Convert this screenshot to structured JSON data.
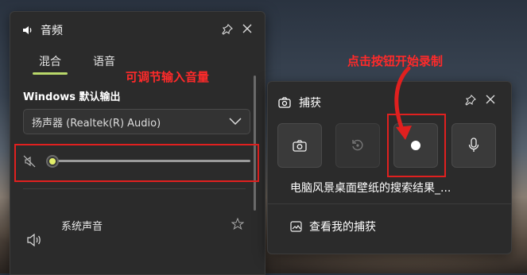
{
  "audio": {
    "title": "音频",
    "tabs": [
      {
        "label": "混合",
        "selected": true
      },
      {
        "label": "语音",
        "selected": false
      }
    ],
    "section_label": "Windows 默认输出",
    "device": "扬声器 (Realtek(R) Audio)",
    "volume": 0,
    "muted": true,
    "app_row_label": "系统声音",
    "accent_color": "#b9d86a"
  },
  "annotations": {
    "volume_hint": "可调节输入音量",
    "record_hint": "点击按钮开始录制",
    "color": "#e0201f"
  },
  "capture": {
    "title": "捕获",
    "filename": "电脑风景桌面壁纸的搜索结果_...",
    "gallery_link": "查看我的捕获",
    "buttons": [
      {
        "name": "screenshot",
        "icon": "camera-icon",
        "enabled": true
      },
      {
        "name": "record-last",
        "icon": "replay-icon",
        "enabled": false
      },
      {
        "name": "start-recording",
        "icon": "record-icon",
        "enabled": true
      },
      {
        "name": "microphone",
        "icon": "microphone-icon",
        "enabled": true
      }
    ]
  }
}
